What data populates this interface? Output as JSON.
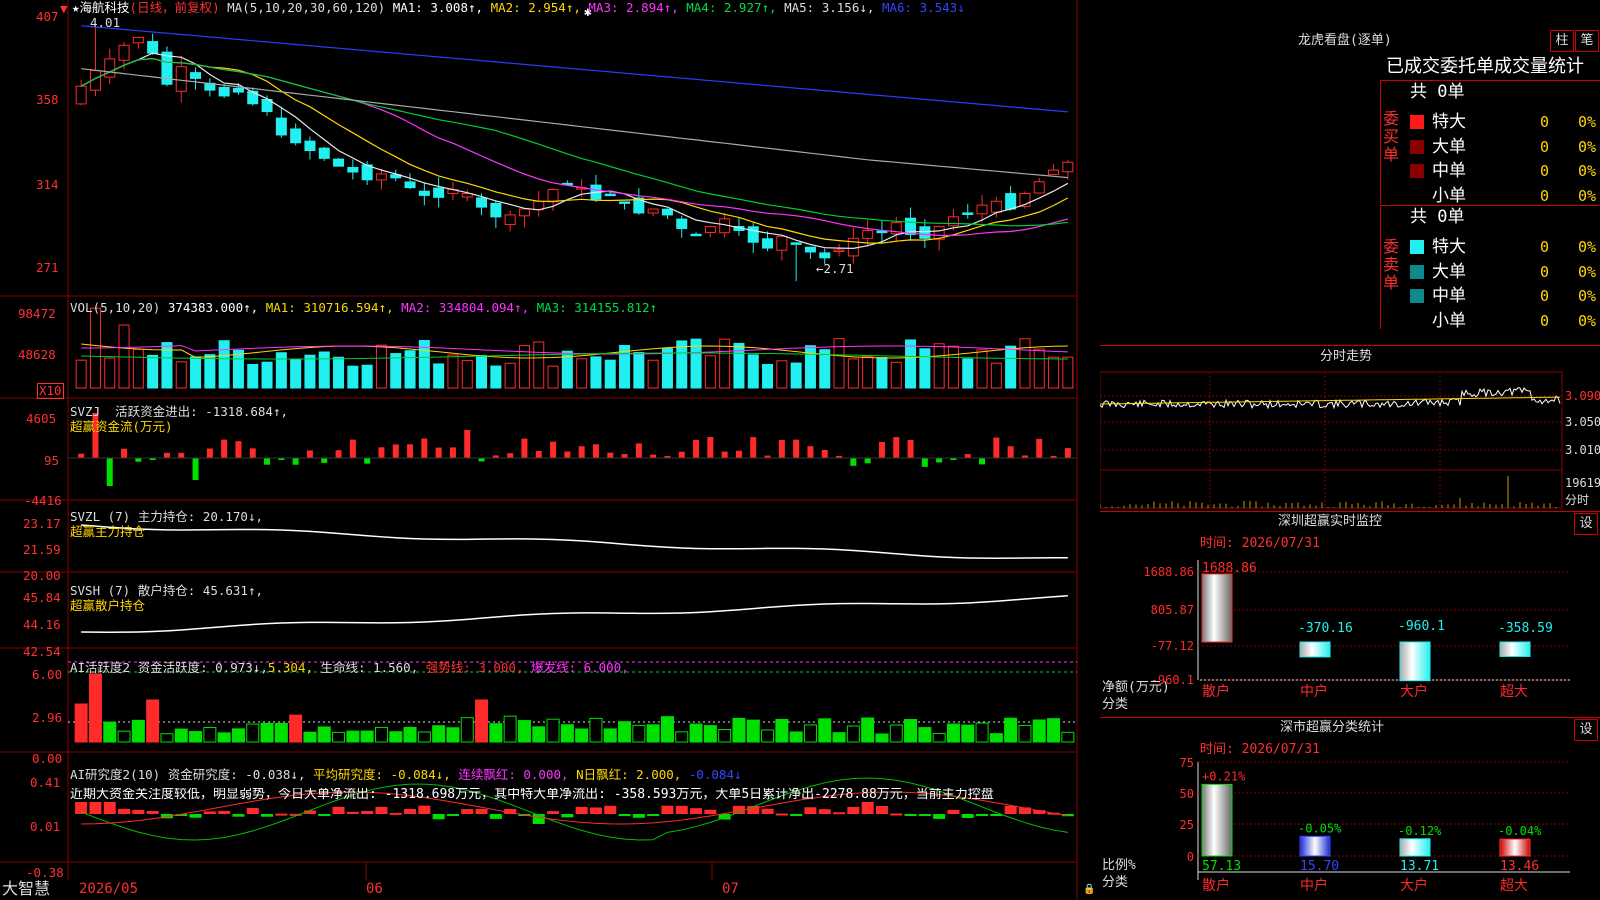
{
  "colors": {
    "up": "#ff2a2a",
    "down": "#22f0f0",
    "grid": "#8a0000",
    "yellow": "#ffd700",
    "magenta": "#ff33ff",
    "green": "#00cc33",
    "blue": "#2b3bff",
    "white": "#e8e8e8",
    "grey": "#aaaaaa",
    "gold": "#bba000"
  },
  "kline": {
    "price_ticks": [
      "407",
      "358",
      "314",
      "271"
    ],
    "hi_label": "4.01",
    "lo_label": "←2.71",
    "header": {
      "star": "★",
      "name": "海航科技",
      "mode": "(日线，前复权)",
      "ma_spec": "MA(5,10,20,30,60,120)",
      "ma1": "MA1: 3.008↑,",
      "ma2": "MA2: 2.954↑,",
      "ma3": "MA3: 2.894↑,",
      "ma4": "MA4: 2.927↑,",
      "ma5": "MA5: 3.156↓,",
      "ma6": "MA6: 3.543↓"
    },
    "closes": [
      3.71,
      3.79,
      3.85,
      3.92,
      3.96,
      3.88,
      3.72,
      3.81,
      3.75,
      3.69,
      3.66,
      3.68,
      3.62,
      3.58,
      3.46,
      3.42,
      3.38,
      3.34,
      3.3,
      3.27,
      3.23,
      3.26,
      3.24,
      3.19,
      3.15,
      3.14,
      3.18,
      3.16,
      3.09,
      3.04,
      3.05,
      3.08,
      3.12,
      3.18,
      3.21,
      3.19,
      3.13,
      3.15,
      3.11,
      3.06,
      3.08,
      3.05,
      2.98,
      2.95,
      2.99,
      3.03,
      2.97,
      2.91,
      2.88,
      2.94,
      2.9,
      2.86,
      2.83,
      2.87,
      2.93,
      2.97,
      2.96,
      3.01,
      2.95,
      2.93,
      2.99,
      3.04,
      3.06,
      3.1,
      3.12,
      3.08,
      3.16,
      3.22,
      3.28,
      3.32
    ]
  },
  "vol": {
    "ticks": [
      "98472",
      "48628"
    ],
    "unit_box": "X10",
    "header": {
      "spec": "VOL(5,10,20)",
      "value": "374383.000↑,",
      "ma1": "MA1: 310716.594↑,",
      "ma2": "MA2: 334804.094↑,",
      "ma3": "MA3: 314155.812↑"
    }
  },
  "svzj": {
    "ticks": [
      "4605",
      "95",
      "-4416"
    ],
    "title": "SVZJ",
    "label": "活跃资金进出: -1318.684↑,",
    "sub": "超赢资金流(万元)"
  },
  "svzl": {
    "ticks": [
      "23.17",
      "21.59",
      "20.00"
    ],
    "title": "SVZL (7)",
    "label": "主力持仓: 20.170↓,",
    "sub": "超赢主力持仓"
  },
  "svsh": {
    "ticks": [
      "45.84",
      "44.16",
      "42.54"
    ],
    "title": "SVSH (7)",
    "label": "散户持仓: 45.631↑,",
    "sub": "超赢散户持仓"
  },
  "ai1": {
    "ticks": [
      "6.00",
      "2.96",
      "0.00"
    ],
    "a": "AI活跃度2",
    "b": "资金活跃度: 0.973↓,",
    "c": "5.304,",
    "d": "生命线: 1.560,",
    "e": "强势线: 3.000,",
    "f": "爆发线: 6.000,"
  },
  "ai2": {
    "ticks": [
      "0.41",
      "0.01",
      "-0.38"
    ],
    "a": "AI研究度2(10)",
    "b": "资金研究度: -0.038↓,",
    "c": "平均研究度: -0.084↓,",
    "d": "连续飘红: 0.000,",
    "e": "N日飘红: 2.000,",
    "f": "-0.084↓",
    "commentary": "近期大资金关注度较低，明显弱势，今日大单净流出: -1318.698万元，其中特大单净流出: -358.593万元，大单5日累计净出-2278.88万元，当前主力控盘"
  },
  "footer": {
    "brand": "大智慧",
    "dates": [
      "2026/05",
      "06",
      "07"
    ]
  },
  "panel": {
    "lhb_title": "龙虎看盘(逐单)",
    "btn1": "柱",
    "btn2": "笔",
    "stat_title": "已成交委托单成交量统计",
    "buy_side": "委买单",
    "sell_side": "委卖单",
    "buy_total": "共 0单",
    "sell_total": "共 0单",
    "rows": [
      {
        "name": "特大",
        "val": "0",
        "pct": "0%"
      },
      {
        "name": "大单",
        "val": "0",
        "pct": "0%"
      },
      {
        "name": "中单",
        "val": "0",
        "pct": "0%"
      },
      {
        "name": "小单",
        "val": "0",
        "pct": "0%"
      }
    ],
    "intraday_title": "分时走势",
    "intraday_ticks": [
      "3.090",
      "3.050",
      "3.010"
    ],
    "intraday_vol": "19619",
    "intraday_unit": "分时",
    "sz1_title": "深圳超赢实时监控",
    "sz1_btn": "设",
    "sz1_time": "时间: 2026/07/31",
    "sz1_ticks": [
      "1688.86",
      "805.87",
      "-77.12",
      "-960.1"
    ],
    "sz1_bars": [
      {
        "cat": "散户",
        "val": "1688.86"
      },
      {
        "cat": "中户",
        "val": "-370.16"
      },
      {
        "cat": "大户",
        "val": "-960.1"
      },
      {
        "cat": "超大",
        "val": "-358.59"
      }
    ],
    "sz1_axis_a": "净额(万元)",
    "sz1_axis_b": "分类",
    "sz2_title": "深市超赢分类统计",
    "sz2_btn": "设",
    "sz2_time": "时间: 2026/07/31",
    "sz2_ticks": [
      "75",
      "50",
      "25",
      "0"
    ],
    "sz2_bars": [
      {
        "cat": "散户",
        "top": "+0.21%",
        "val": "57.13"
      },
      {
        "cat": "中户",
        "top": "-0.05%",
        "val": "15.70"
      },
      {
        "cat": "大户",
        "top": "-0.12%",
        "val": "13.71"
      },
      {
        "cat": "超大",
        "top": "-0.04%",
        "val": "13.46"
      }
    ],
    "sz2_axis_a": "比例%",
    "sz2_axis_b": "分类"
  }
}
